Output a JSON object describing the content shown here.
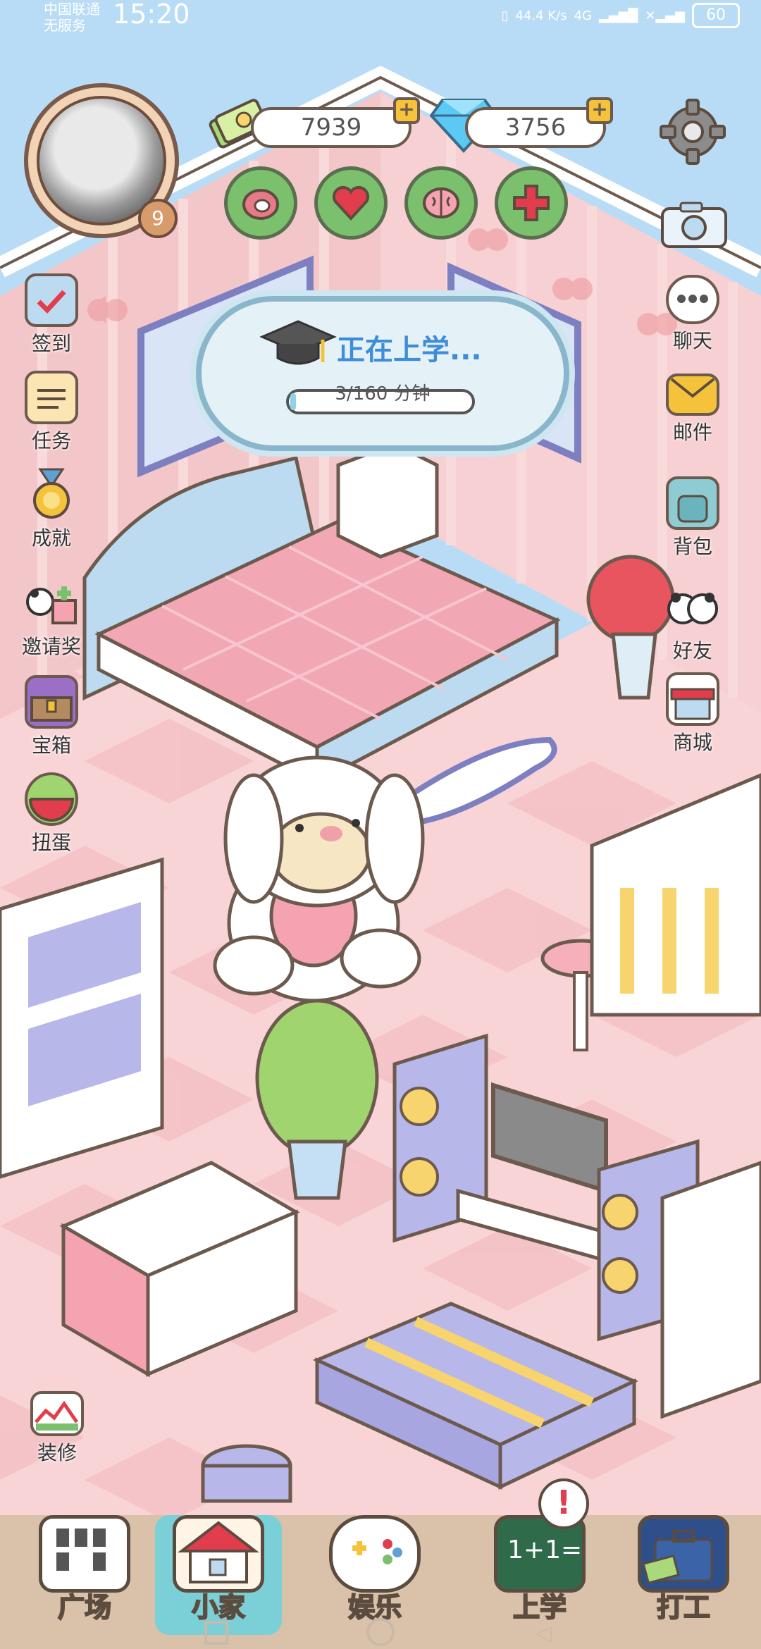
{
  "status": {
    "carrier_line1": "中国联通",
    "carrier_line2": "无服务",
    "time": "15:20",
    "net_speed": "44.4 K/s",
    "network": "4G",
    "battery": "60"
  },
  "player": {
    "level": "9"
  },
  "resources": {
    "coins": "7939",
    "diamonds": "3756"
  },
  "stats": [
    {
      "icon": "meat-icon"
    },
    {
      "icon": "heart-icon"
    },
    {
      "icon": "brain-icon"
    },
    {
      "icon": "health-cross-icon"
    }
  ],
  "left_menu": [
    {
      "label": "签到",
      "icon": "checkin-calendar-icon"
    },
    {
      "label": "任务",
      "icon": "task-clipboard-icon"
    },
    {
      "label": "成就",
      "icon": "medal-icon"
    },
    {
      "label": "邀请奖",
      "icon": "gift-icon"
    },
    {
      "label": "宝箱",
      "icon": "treasure-chest-icon"
    },
    {
      "label": "扭蛋",
      "icon": "gacha-icon"
    },
    {
      "label": "装修",
      "icon": "decorate-icon"
    }
  ],
  "right_menu": [
    {
      "label": "聊天",
      "icon": "chat-bubble-icon"
    },
    {
      "label": "邮件",
      "icon": "mail-icon"
    },
    {
      "label": "背包",
      "icon": "backpack-icon"
    },
    {
      "label": "好友",
      "icon": "friends-icon"
    },
    {
      "label": "商城",
      "icon": "shop-icon"
    }
  ],
  "school_banner": {
    "title": "正在上学...",
    "progress_text": "3/160 分钟",
    "progress_fraction": 0.019
  },
  "bottom_nav": [
    {
      "label": "广场",
      "icon": "plaza-icon"
    },
    {
      "label": "小家",
      "icon": "home-icon"
    },
    {
      "label": "娱乐",
      "icon": "gamepad-icon"
    },
    {
      "label": "上学",
      "icon": "blackboard-icon"
    },
    {
      "label": "打工",
      "icon": "briefcase-icon"
    }
  ],
  "colors": {
    "sky": "#b9dcf6",
    "wall": "#f3c7c9",
    "floor_light": "#fbe4e6",
    "floor_dark": "#f4c3c7",
    "accent_green": "#7bc06c",
    "accent_blue": "#3d8dd8"
  }
}
